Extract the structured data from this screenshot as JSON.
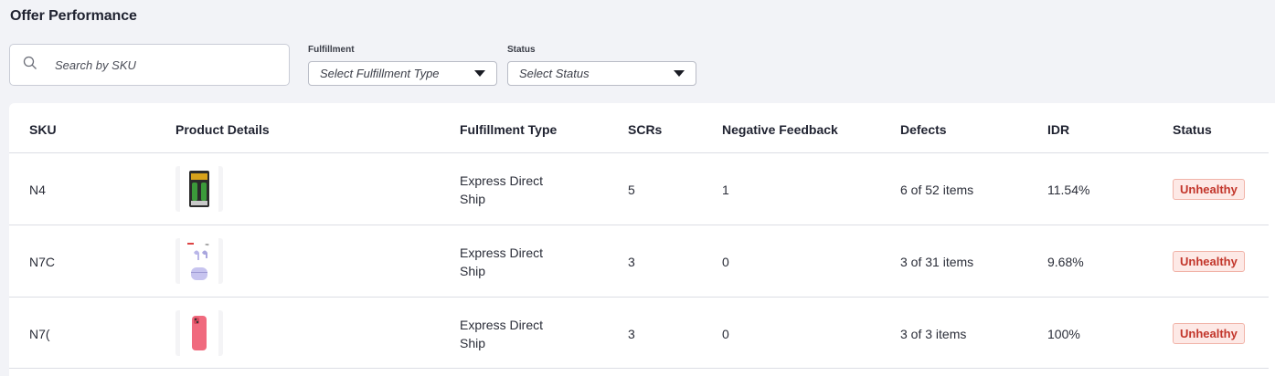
{
  "page": {
    "title": "Offer Performance"
  },
  "search": {
    "placeholder": "Search by SKU",
    "value": ""
  },
  "filters": {
    "fulfillment": {
      "label": "Fulfillment",
      "selected": "Select Fulfillment Type"
    },
    "status": {
      "label": "Status",
      "selected": "Select Status"
    }
  },
  "table": {
    "headers": {
      "sku": "SKU",
      "product": "Product Details",
      "fulfillment": "Fulfillment Type",
      "scrs": "SCRs",
      "negative": "Negative Feedback",
      "defects": "Defects",
      "idr": "IDR",
      "status": "Status"
    },
    "rows": [
      {
        "sku": "N4",
        "product_icon": "battery-pack-image",
        "fulfillment_line1": "Express Direct",
        "fulfillment_line2": "Ship",
        "scrs": "5",
        "negative": "1",
        "defects": "6 of 52 items",
        "idr": "11.54%",
        "status": "Unhealthy"
      },
      {
        "sku": "N7C",
        "product_icon": "earbuds-image",
        "fulfillment_line1": "Express Direct",
        "fulfillment_line2": "Ship",
        "scrs": "3",
        "negative": "0",
        "defects": "3 of 31 items",
        "idr": "9.68%",
        "status": "Unhealthy"
      },
      {
        "sku": "N7(",
        "product_icon": "phone-case-image",
        "fulfillment_line1": "Express Direct",
        "fulfillment_line2": "Ship",
        "scrs": "3",
        "negative": "0",
        "defects": "3 of 3 items",
        "idr": "100%",
        "status": "Unhealthy"
      }
    ]
  },
  "colors": {
    "unhealthy_text": "#c2352a",
    "unhealthy_bg": "#fde9e6",
    "page_bg": "#f2f3f7"
  }
}
